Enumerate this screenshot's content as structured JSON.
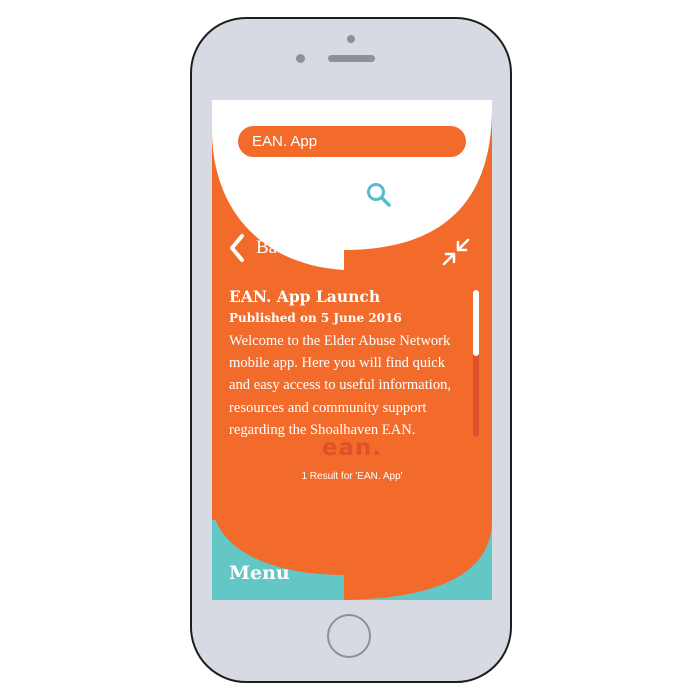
{
  "search": {
    "query": "EAN. App"
  },
  "nav": {
    "back_label": "Back"
  },
  "article": {
    "title": "EAN. App Launch",
    "published": "Published on 5 June 2016",
    "lines": [
      "Welcome to the Elder Abuse Network",
      "mobile app. Here you will find quick",
      "and easy access to useful information,",
      "resources  and community support",
      "regarding the Shoalhaven EAN."
    ]
  },
  "logo": {
    "text": "ean."
  },
  "results": {
    "summary": "1 Result for 'EAN. App'"
  },
  "menu": {
    "label": "Menu"
  },
  "icons": {
    "search": "search-icon",
    "back": "chevron-left-icon",
    "collapse": "collapse-arrows-icon"
  },
  "colors": {
    "accent_orange": "#f26b2b",
    "teal": "#63c7c6",
    "dark_orange": "#e0502b",
    "white": "#ffffff",
    "phone_body": "#d7dae3",
    "phone_outline": "#1e1e1e",
    "icon_teal": "#5bbccc"
  },
  "scrollbar": {
    "position_fraction": 0
  }
}
